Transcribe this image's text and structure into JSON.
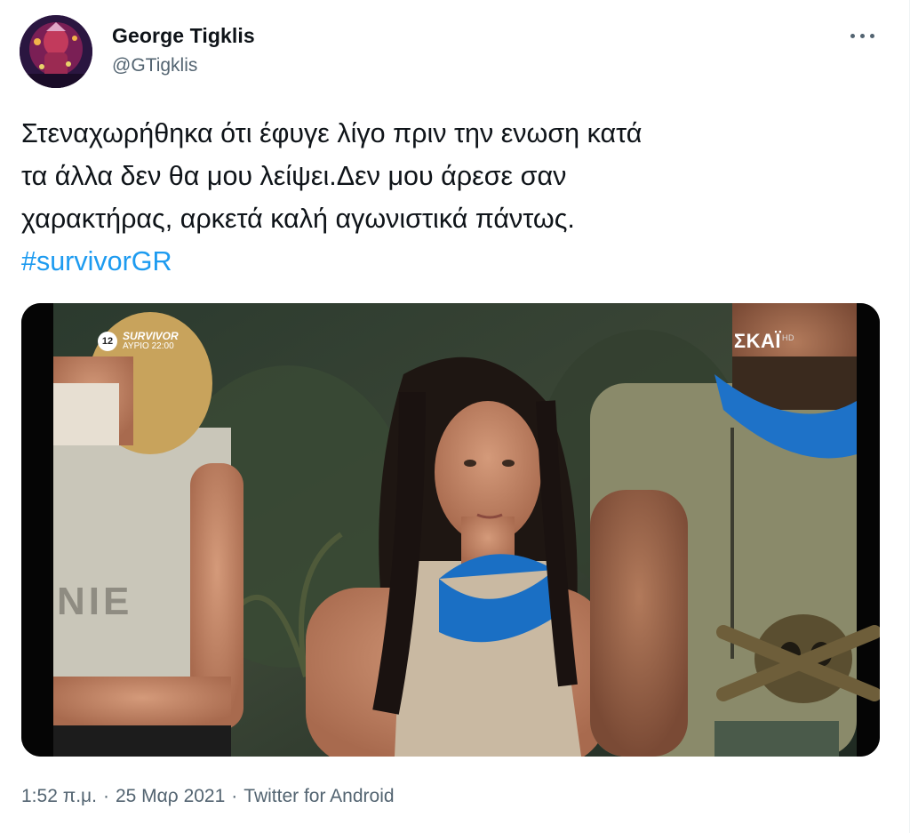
{
  "author": {
    "name": "George Tigklis",
    "handle": "@GTigklis"
  },
  "tweet": {
    "lines": [
      "Στεναχωρήθηκα ότι έφυγε λίγο πριν την ενωση κατά",
      "τα άλλα δεν θα μου λείψει.Δεν μου άρεσε σαν",
      "χαρακτήρας, αρκετά καλή αγωνιστικά πάντως."
    ],
    "hashtag": "#survivorGR"
  },
  "media": {
    "overlay_channel_number": "12",
    "overlay_show": "SURVIVOR",
    "overlay_schedule": "ΑΥΡΙΟ 22:00",
    "overlay_network": "ΣΚΑΪ",
    "overlay_network_suffix": "HD",
    "shirt_text": "NIE"
  },
  "meta": {
    "time": "1:52 π.μ.",
    "separator": "·",
    "date": "25 Μαρ 2021",
    "source": "Twitter for Android"
  },
  "colors": {
    "link": "#1d9bf0",
    "secondary_text": "#536471",
    "primary_text": "#0f1419",
    "buff_blue": "#1a6fc4"
  },
  "icons": {
    "more": "more-horizontal-icon"
  }
}
